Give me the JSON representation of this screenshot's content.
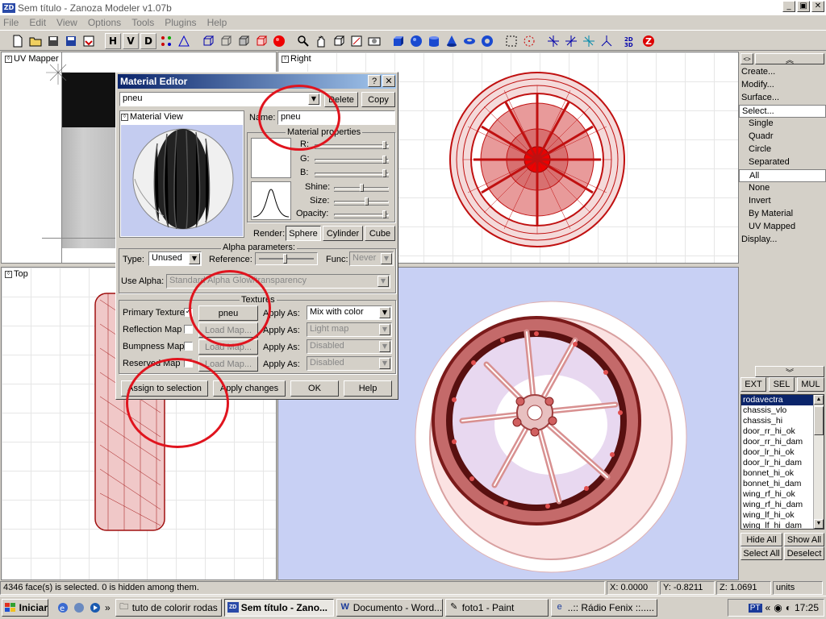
{
  "window": {
    "title": "Sem título - Zanoza Modeler v1.07b",
    "logo": "ZD",
    "minimize": "_",
    "maximize": "▣",
    "close": "✕"
  },
  "menu": [
    "File",
    "Edit",
    "View",
    "Options",
    "Tools",
    "Plugins",
    "Help"
  ],
  "toolbar": {
    "h": "H",
    "v": "V",
    "d": "D",
    "icons": [
      "new-icon",
      "open-icon",
      "save-icon",
      "save-as-icon",
      "import-icon",
      "h-button",
      "v-button",
      "d-button",
      "wand-icon",
      "vertex-icon",
      "cube-wire-icon",
      "cube-wire2-icon",
      "cube-solid-icon",
      "cube-red-icon",
      "sphere-red-icon",
      "zoom-icon",
      "hand-icon",
      "box-icon",
      "frame-icon",
      "camera-icon",
      "cube-blue-icon",
      "sphere-blue-icon",
      "cylinder-blue-icon",
      "cone-blue-icon",
      "torus-blue-icon",
      "torus2-blue-icon",
      "select-rect-icon",
      "select-circle-icon",
      "move-icon",
      "rotate-icon",
      "scale-icon",
      "axis-icon",
      "3d-label-icon",
      "z-icon"
    ]
  },
  "viewports": {
    "uv": "UV Mapper",
    "right": "Right",
    "top": "Top"
  },
  "material_editor": {
    "title": "Material Editor",
    "help_btn": "?",
    "close_btn": "✕",
    "material_select": "pneu",
    "delete": "Delete",
    "copy": "Copy",
    "name_label": "Name:",
    "name_value": "pneu",
    "material_view": "Material View",
    "props_group": "Material properties",
    "r": "R:",
    "g": "G:",
    "b": "B:",
    "shine": "Shine:",
    "size": "Size:",
    "opacity": "Opacity:",
    "render_label": "Render:",
    "render_opts": [
      "Sphere",
      "Cylinder",
      "Cube"
    ],
    "alpha_group": "Alpha parameters:",
    "type_label": "Type:",
    "type_value": "Unused",
    "reference_label": "Reference:",
    "func_label": "Func:",
    "func_value": "Never",
    "use_alpha_label": "Use Alpha:",
    "use_alpha_value": "Standard Alpha Glow/transparency",
    "textures_group": "Textures",
    "primary_texture": "Primary Texture",
    "reflection_map": "Reflection Map",
    "bumpness_map": "Bumpness Map",
    "reserved_map": "Reserved Map",
    "primary_btn": "pneu",
    "load_map": "Load Map...",
    "apply_as": "Apply As:",
    "apply_primary": "Mix with color",
    "apply_reflection": "Light map",
    "apply_bumpness": "Disabled",
    "apply_reserved": "Disabled",
    "assign": "Assign to selection",
    "apply_changes": "Apply changes",
    "ok": "OK",
    "help": "Help",
    "checkmark": "✓"
  },
  "right_panel": {
    "collapse": "<>",
    "up": "︽",
    "down": "︾",
    "menu": [
      "Create...",
      "Modify...",
      "Surface...",
      "Select..."
    ],
    "select_sub": [
      "Single",
      "Quadr",
      "Circle",
      "Separated",
      "All",
      "None",
      "Invert",
      "By Material",
      "UV Mapped"
    ],
    "display": "Display...",
    "tabs": [
      "EXT",
      "SEL",
      "MUL"
    ],
    "objects": [
      "rodavectra",
      "chassis_vlo",
      "chassis_hi",
      "door_rr_hi_ok",
      "door_rr_hi_dam",
      "door_lr_hi_ok",
      "door_lr_hi_dam",
      "bonnet_hi_ok",
      "bonnet_hi_dam",
      "wing_rf_hi_ok",
      "wing_rf_hi_dam",
      "wing_lf_hi_ok",
      "wing_lf_hi_dam"
    ],
    "hide_all": "Hide All",
    "show_all": "Show All",
    "select_all": "Select All",
    "deselect": "Deselect"
  },
  "status": {
    "message": "4346 face(s) is selected. 0 is hidden among them.",
    "x": "X: 0.0000",
    "y": "Y: -0.8211",
    "z": "Z: 1.0691",
    "units": "units"
  },
  "taskbar": {
    "start": "Iniciar",
    "tasks": [
      "tuto de colorir rodas",
      "Sem título - Zano...",
      "Documento - Word...",
      "foto1 - Paint",
      "..:: Rádio Fenix ::....."
    ],
    "lang": "PT",
    "chev": "«",
    "quick_chev": "»",
    "clock": "17:25"
  }
}
